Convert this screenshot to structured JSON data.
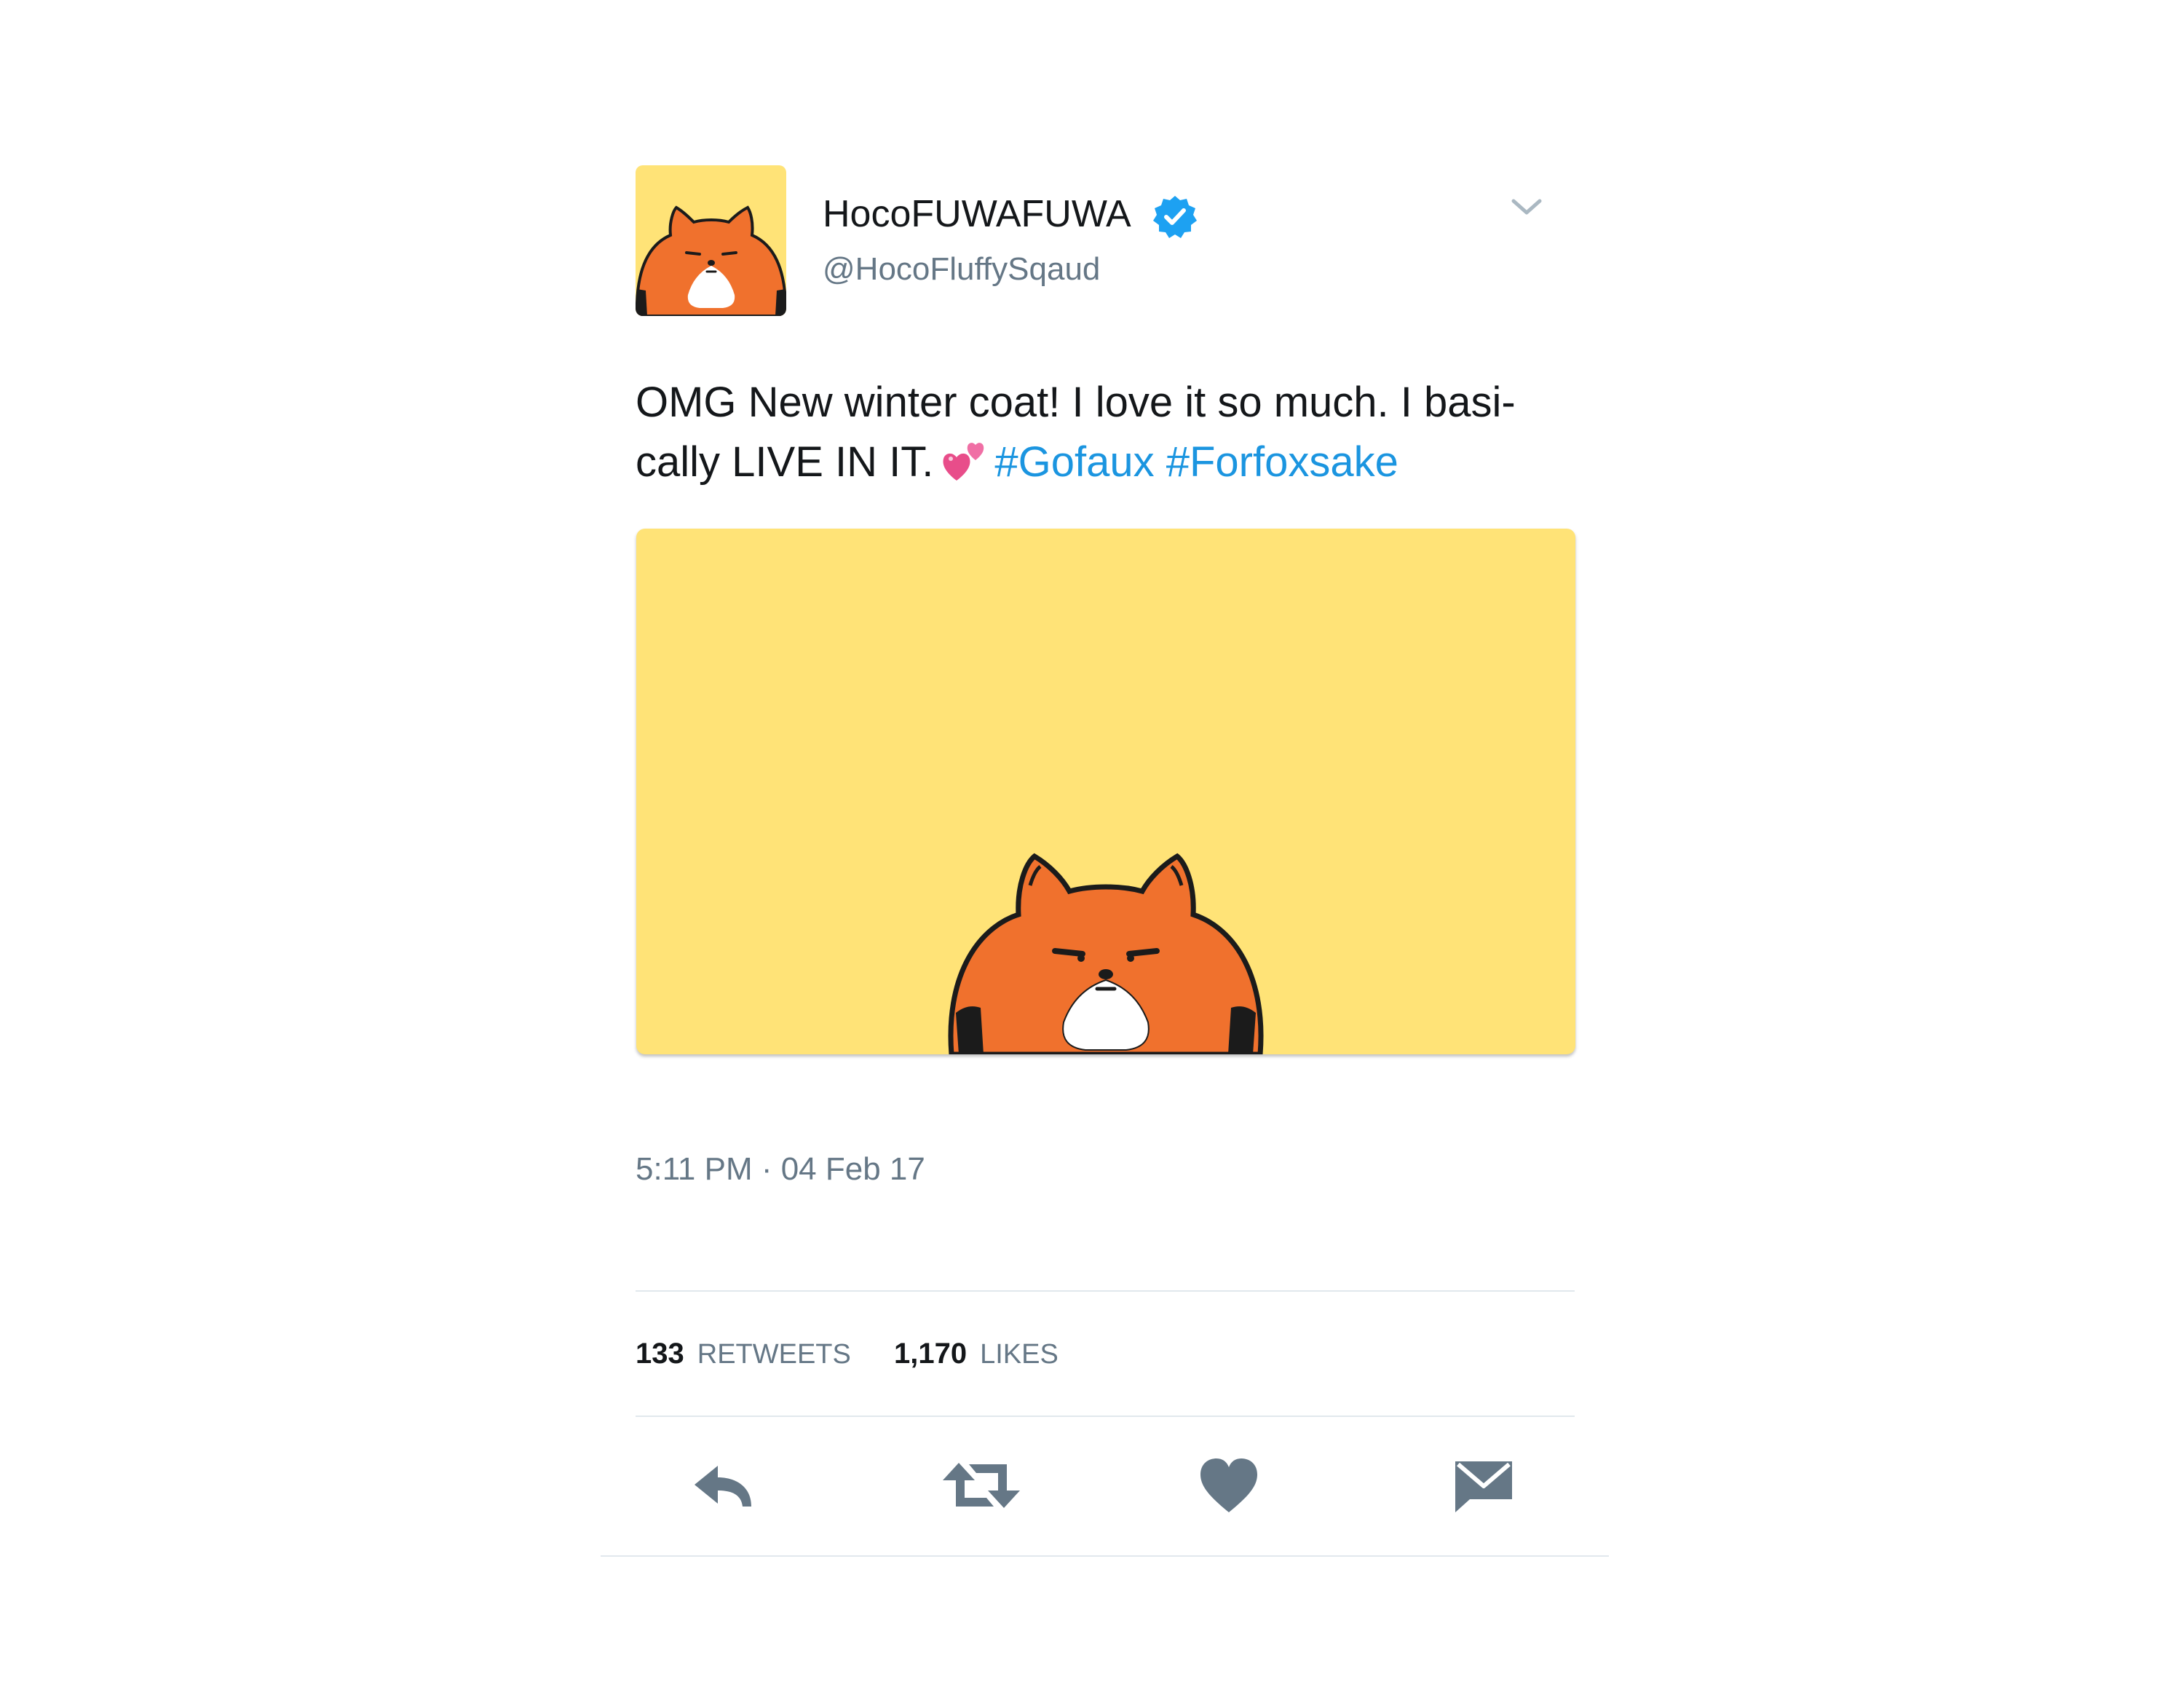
{
  "tweet": {
    "display_name": "HocoFUWAFUWA",
    "handle": "@HocoFluffySqaud",
    "text_line1": "OMG New winter coat! I love it so much. I basi-",
    "text_line2": "cally LIVE IN IT.",
    "hashtags": [
      "#Gofaux",
      "#Forfoxsake"
    ],
    "timestamp": "5:11 PM · 04 Feb 17"
  },
  "stats": {
    "retweets_count": "133",
    "retweets_label": "RETWEETS",
    "likes_count": "1,170",
    "likes_label": "LIKES"
  },
  "icons": {
    "verified": "verified-badge-icon",
    "caret": "chevron-down-icon",
    "emoji": "two-hearts-emoji",
    "reply": "reply-icon",
    "retweet": "retweet-icon",
    "like": "heart-icon",
    "message": "direct-message-icon"
  },
  "colors": {
    "hashtag": "#1b95e0",
    "muted_text": "#657786",
    "action_icon": "#657786",
    "verified_badge": "#1da1f2",
    "media_background": "#ffe377",
    "fox_orange": "#f0712d"
  }
}
